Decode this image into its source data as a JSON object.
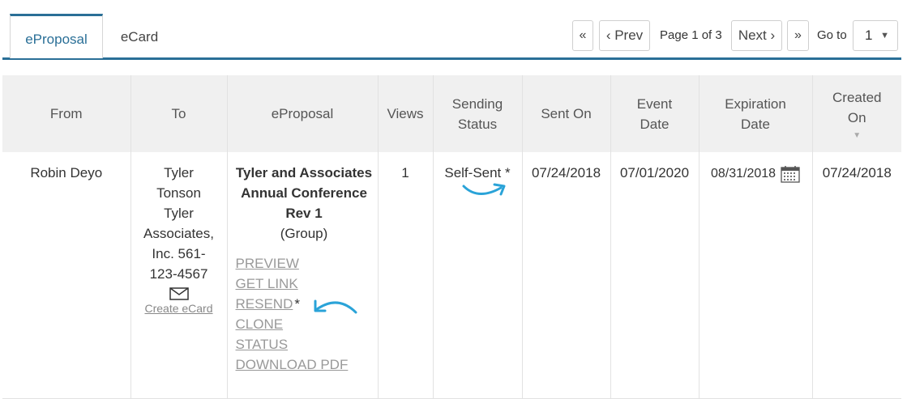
{
  "tabs": [
    {
      "label": "eProposal",
      "active": true
    },
    {
      "label": "eCard",
      "active": false
    }
  ],
  "pagination": {
    "first": "«",
    "prev": "‹ Prev",
    "page_info": "Page 1 of 3",
    "next": "Next ›",
    "last": "»",
    "goto_label": "Go to",
    "goto_value": "1"
  },
  "table": {
    "headers": {
      "from": "From",
      "to": "To",
      "eproposal": "eProposal",
      "views": "Views",
      "sending_status_1": "Sending",
      "sending_status_2": "Status",
      "sent_on": "Sent On",
      "event_date_1": "Event",
      "event_date_2": "Date",
      "expiration_date_1": "Expiration",
      "expiration_date_2": "Date",
      "created_on_1": "Created",
      "created_on_2": "On"
    },
    "row": {
      "from": "Robin Deyo",
      "to_lines": [
        "Tyler",
        "Tonson",
        "Tyler",
        "Associates,",
        "Inc. 561-",
        "123-4567"
      ],
      "create_ecard": "Create eCard",
      "proposal_title": "Tyler and Associates Annual Conference Rev 1",
      "proposal_group": "(Group)",
      "actions": {
        "preview": "PREVIEW",
        "get_link": "GET LINK",
        "resend": "RESEND",
        "resend_star": "*",
        "clone": "CLONE",
        "status": "STATUS",
        "download_pdf": "DOWNLOAD PDF"
      },
      "views": "1",
      "sending_status": "Self-Sent *",
      "sent_on": "07/24/2018",
      "event_date": "07/01/2020",
      "expiration_date": "08/31/2018",
      "created_on": "07/24/2018"
    }
  },
  "colors": {
    "accent": "#2a6f97",
    "annotation_arrow": "#2aa3d8",
    "header_bg": "#f0f0f0"
  },
  "icons": [
    "mail-icon",
    "calendar-icon",
    "sort-down-icon",
    "select-caret-icon"
  ]
}
